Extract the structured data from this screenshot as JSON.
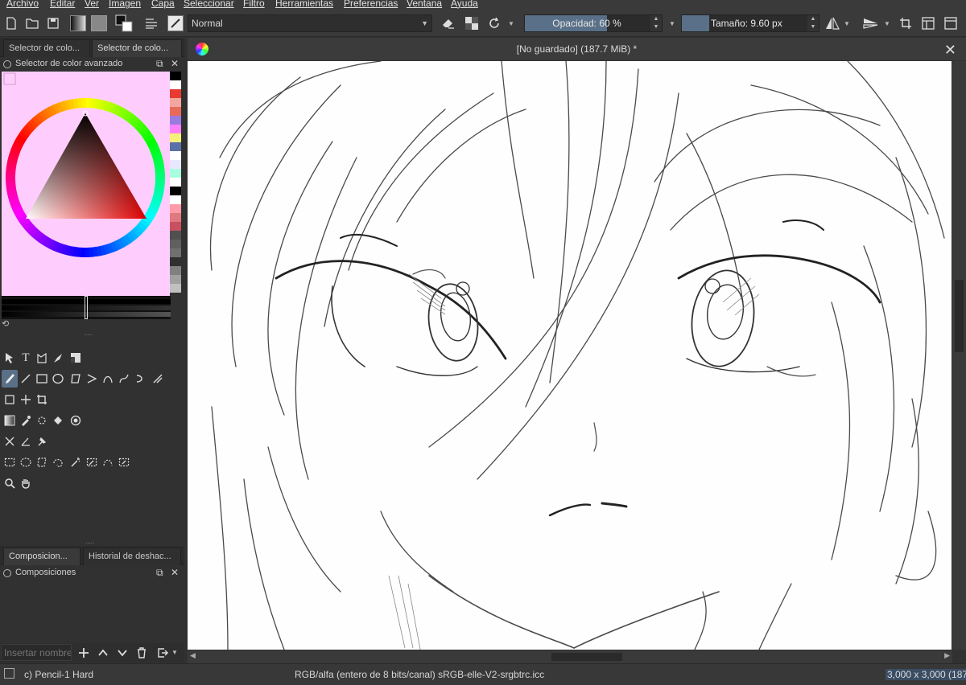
{
  "menu": {
    "items": [
      "Archivo",
      "Editar",
      "Ver",
      "Imagen",
      "Capa",
      "Seleccionar",
      "Filtro",
      "Herramientas",
      "Preferencias",
      "Ventana",
      "Ayuda"
    ]
  },
  "toolbar": {
    "blend_mode": "Normal",
    "opacity_label": "Opacidad: 60 %",
    "opacity_value": 0.6,
    "size_label": "Tamaño: 9.60 px"
  },
  "left_dock": {
    "tabs": [
      "Selector de colo...",
      "Selector de colo..."
    ],
    "color_panel_title": "Selector de color avanzado",
    "color_bg": "#ffcdfd",
    "swatches": [
      "#000000",
      "#ffffff",
      "#e83a30",
      "#f3a6a0",
      "#e86a5a",
      "#9a7be0",
      "#ff80ff",
      "#f5f07a",
      "#5a70a8",
      "#ffffff",
      "#e8e8ff",
      "#a8ffe0",
      "#ffffff",
      "#000000",
      "#ffffff",
      "#ff9aa8",
      "#e07880",
      "#c85060",
      "#505050",
      "#606060",
      "#707070",
      "#303030",
      "#808080",
      "#a0a0a0",
      "#c0c0c0"
    ],
    "bottom_tabs": [
      "Composicion...",
      "Historial de deshac..."
    ],
    "comp_panel_title": "Composiciones",
    "insert_name_placeholder": "Insertar nombre"
  },
  "canvas": {
    "title": "[No guardado]  (187.7 MiB) *"
  },
  "status": {
    "brush": "c) Pencil-1 Hard",
    "color_model": "RGB/alfa (entero de 8 bits/canal)  sRGB-elle-V2-srgbtrc.icc",
    "dimensions": "3,000 x 3,000 (187"
  }
}
